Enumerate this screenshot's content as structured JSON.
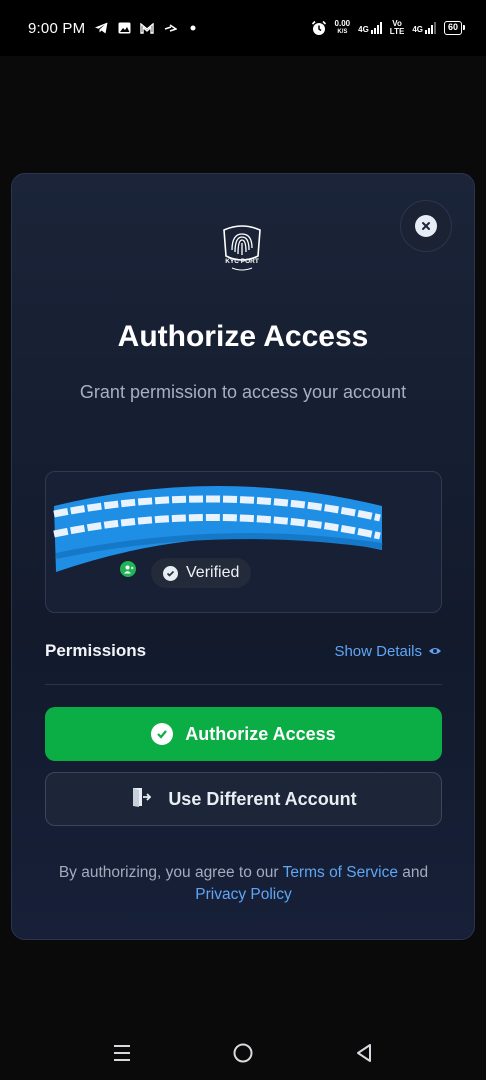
{
  "status_bar": {
    "time": "9:00 PM",
    "net_speed_value": "0.00",
    "net_speed_unit": "K/S",
    "sim1_label": "4G",
    "sim2_label_top": "Vo",
    "sim2_label_bottom": "LTE",
    "sim2_net": "4G",
    "battery": "60",
    "left_icons": [
      "telegram-icon",
      "gallery-icon",
      "gmail-icon",
      "airtel-icon",
      "dot-icon"
    ],
    "right_icons": [
      "alarm-icon",
      "signal-icon",
      "battery-icon"
    ]
  },
  "modal": {
    "logo_text": "KYC PORT",
    "title": "Authorize Access",
    "subtitle": "Grant permission to access your account",
    "account": {
      "verified_label": "Verified"
    },
    "permissions_label": "Permissions",
    "show_details_label": "Show Details",
    "authorize_button": "Authorize Access",
    "different_account_button": "Use Different Account",
    "legal_prefix": "By authorizing, you agree to our",
    "terms_link": "Terms of Service",
    "legal_and": "and",
    "privacy_link": "Privacy Policy"
  },
  "colors": {
    "accent_green": "#0bad45",
    "link_blue": "#5fa6f5",
    "card_bg": "#172035"
  },
  "nav_bar": {
    "icons": [
      "menu-icon",
      "home-icon",
      "back-icon"
    ]
  }
}
